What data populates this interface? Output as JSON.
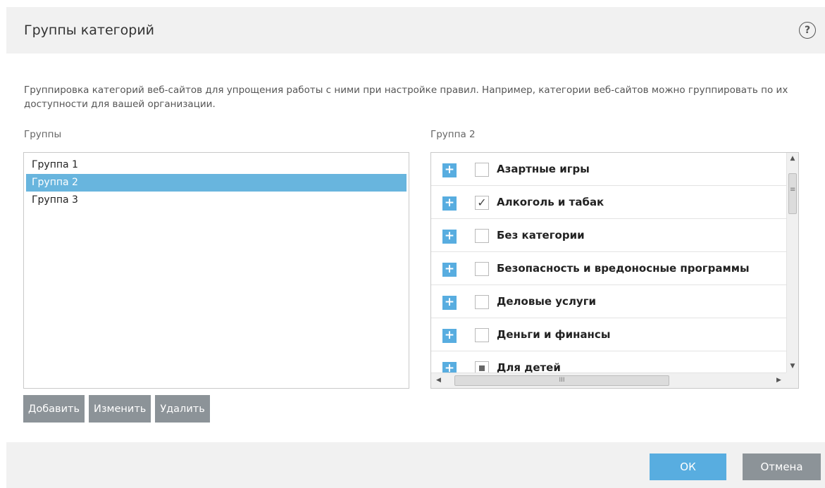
{
  "dialog": {
    "title": "Группы категорий",
    "help_icon": "?"
  },
  "description": "Группировка категорий веб-сайтов для упрощения работы с ними при настройке правил. Например, категории веб-сайтов можно группировать по их доступности для вашей организации.",
  "groups": {
    "label": "Группы",
    "items": [
      {
        "label": "Группа 1",
        "selected": false
      },
      {
        "label": "Группа 2",
        "selected": true
      },
      {
        "label": "Группа 3",
        "selected": false
      }
    ]
  },
  "buttons": {
    "add": "Добавить",
    "edit": "Изменить",
    "delete": "Удалить"
  },
  "categories": {
    "label": "Группа 2",
    "expand_icon": "+",
    "items": [
      {
        "label": "Азартные игры",
        "state": "unchecked"
      },
      {
        "label": "Алкоголь и табак",
        "state": "checked"
      },
      {
        "label": "Без категории",
        "state": "unchecked"
      },
      {
        "label": "Безопасность и вредоносные программы",
        "state": "unchecked"
      },
      {
        "label": "Деловые услуги",
        "state": "unchecked"
      },
      {
        "label": "Деньги и финансы",
        "state": "unchecked"
      },
      {
        "label": "Для детей",
        "state": "partial"
      }
    ],
    "scroll_arrows": {
      "up": "▲",
      "down": "▼",
      "left": "◀",
      "right": "▶"
    },
    "hscroll_grip": "III"
  },
  "footer": {
    "ok": "ОК",
    "cancel": "Отмена"
  },
  "colors": {
    "accent": "#58ade0",
    "selection": "#68b5de",
    "secondary_button": "#8c9398",
    "panel_bg": "#f1f1f1"
  }
}
